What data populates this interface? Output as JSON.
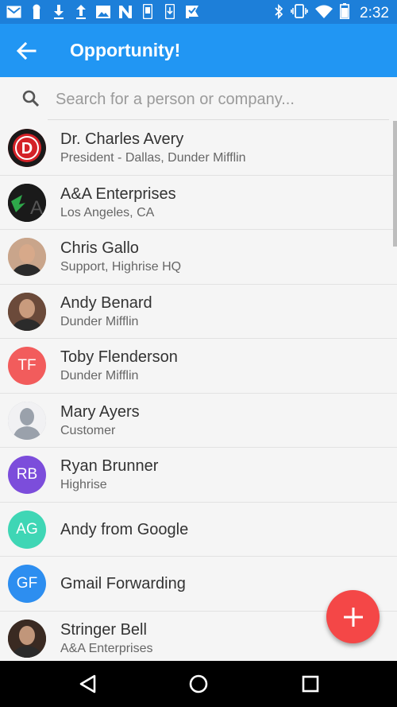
{
  "status_bar": {
    "time": "2:32",
    "left_icons": [
      "mail-icon",
      "bookmark-icon",
      "download-icon",
      "upload-icon",
      "image-icon",
      "n-app-icon",
      "phone-icon",
      "phone-download-icon",
      "check-flag-icon"
    ],
    "right_icons": [
      "bluetooth-icon",
      "vibrate-icon",
      "wifi-icon",
      "battery-icon"
    ]
  },
  "app_bar": {
    "title": "Opportunity!"
  },
  "search": {
    "placeholder": "Search for a person or company..."
  },
  "contacts": [
    {
      "name": "Dr. Charles Avery",
      "subtitle": "President - Dallas, Dunder Mifflin",
      "avatar_type": "logo",
      "color": "#d42127"
    },
    {
      "name": "A&A Enterprises",
      "subtitle": "Los Angeles, CA",
      "avatar_type": "logo",
      "color": "#1a1a1a"
    },
    {
      "name": "Chris Gallo",
      "subtitle": "Support, Highrise HQ",
      "avatar_type": "photo",
      "color": "#c9a58b"
    },
    {
      "name": "Andy Benard",
      "subtitle": "Dunder Mifflin",
      "avatar_type": "photo",
      "color": "#6b4a3a"
    },
    {
      "name": "Toby Flenderson",
      "subtitle": "Dunder Mifflin",
      "avatar_type": "initials",
      "initials": "TF",
      "color": "#f25c5c"
    },
    {
      "name": "Mary Ayers",
      "subtitle": "Customer",
      "avatar_type": "placeholder",
      "color": "#a8adb5"
    },
    {
      "name": "Ryan Brunner",
      "subtitle": "Highrise",
      "avatar_type": "initials",
      "initials": "RB",
      "color": "#7c4ddb"
    },
    {
      "name": "Andy from Google",
      "subtitle": "",
      "avatar_type": "initials",
      "initials": "AG",
      "color": "#3fd6b5"
    },
    {
      "name": "Gmail Forwarding",
      "subtitle": "",
      "avatar_type": "initials",
      "initials": "GF",
      "color": "#2d8ef0"
    },
    {
      "name": "Stringer Bell",
      "subtitle": "A&A Enterprises",
      "avatar_type": "photo",
      "color": "#3a2a22"
    }
  ],
  "fab": {
    "icon": "plus-icon",
    "color": "#f44747"
  },
  "nav_bar": {
    "icons": [
      "back-triangle-icon",
      "home-circle-icon",
      "recents-square-icon"
    ]
  },
  "colors": {
    "status_bar": "#1d7fd9",
    "app_bar": "#2196f3"
  }
}
